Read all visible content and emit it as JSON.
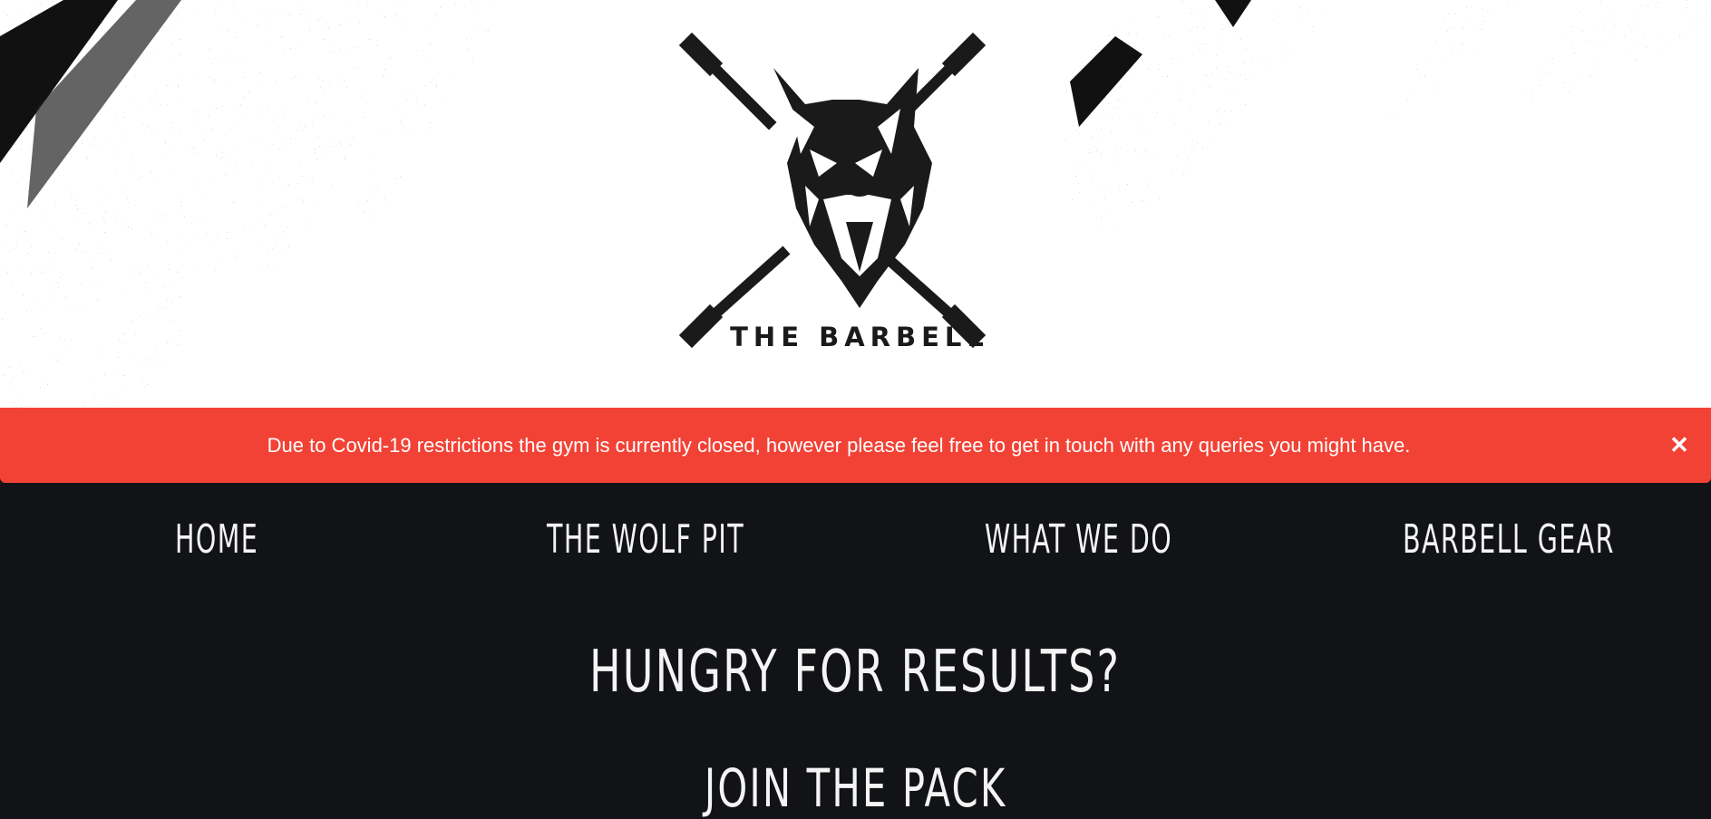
{
  "hero": {
    "logo_icon": "wolf-crossed-barbells-icon",
    "brand_name": "THE BARBELL"
  },
  "alert": {
    "message": "Due to Covid-19 restrictions the gym is currently closed, however please feel free to get in touch with any queries you might have.",
    "close_label": "✕",
    "color": "#f24236"
  },
  "nav": {
    "items": [
      {
        "label": "HOME"
      },
      {
        "label": "THE WOLF PIT"
      },
      {
        "label": "WHAT WE DO"
      },
      {
        "label": "BARBELL GEAR"
      }
    ]
  },
  "main": {
    "heading": "HUNGRY FOR RESULTS?",
    "subheading": "JOIN THE PACK"
  },
  "colors": {
    "background": "#121316",
    "accent": "#f24236",
    "text": "#f4f4f4"
  }
}
